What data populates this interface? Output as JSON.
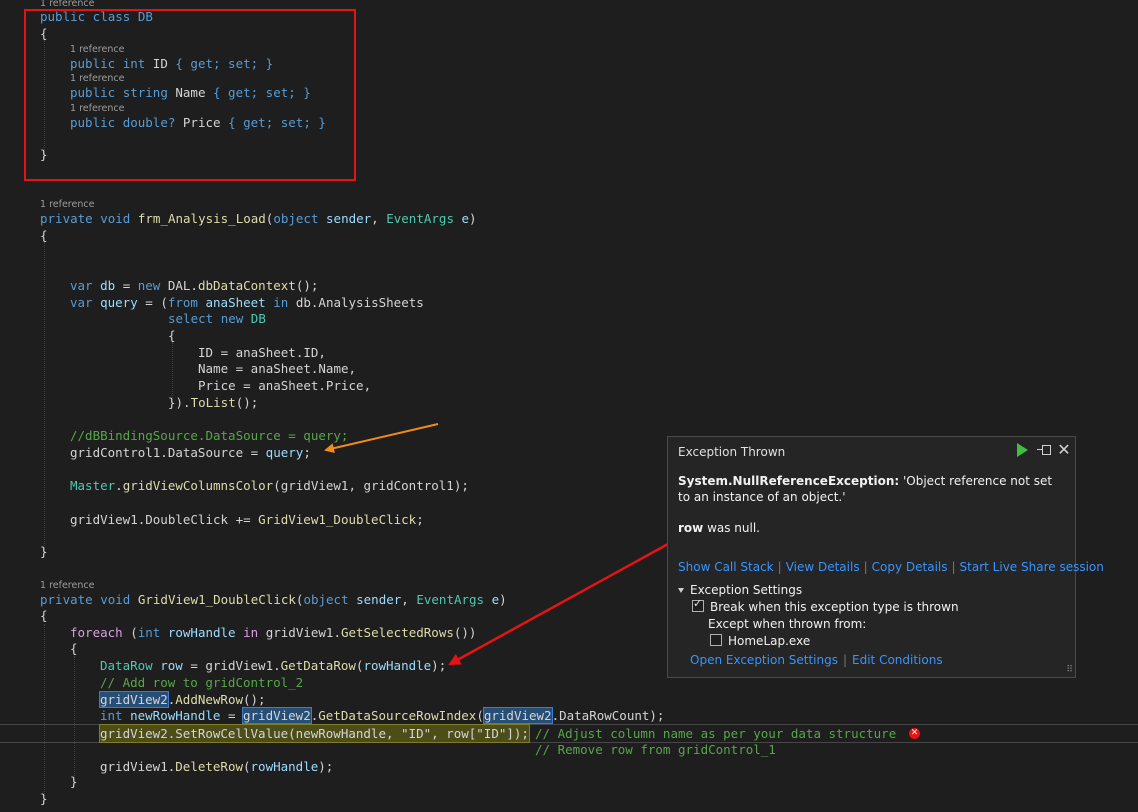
{
  "codelens": {
    "one_ref": "1 reference"
  },
  "code": {
    "db_class": "public class DB",
    "open_brace": "{",
    "close_brace": "}",
    "id_prop": {
      "kw1": "public",
      "kw2": "int",
      "name": " ID ",
      "body": "{ get; set; }"
    },
    "name_prop": {
      "kw1": "public",
      "kw2": "string",
      "name": " Name ",
      "body": "{ get; set; }"
    },
    "price_prop": {
      "kw1": "public",
      "kw2": "double?",
      "name": " Price ",
      "body": "{ get; set; }"
    },
    "load_sig": {
      "kw1": "private",
      "kw2": "void",
      "fn": "frm_Analysis_Load",
      "p1": "object",
      "p1n": "sender",
      "p2": "EventArgs",
      "p2n": "e"
    },
    "var_db": {
      "kw": "var",
      "v": "db",
      "eq": " = ",
      "new": "new",
      "ns": "DAL.",
      "fn": "dbDataContext",
      "end": "();"
    },
    "var_query": {
      "kw": "var",
      "v": "query",
      "eq": " = (",
      "from": "from",
      "vn": "anaSheet",
      "in": "in",
      "src": "db.AnalysisSheets"
    },
    "select_new": {
      "select": "select",
      "new": "new",
      "ty": "DB"
    },
    "assign_id": "ID = anaSheet.ID,",
    "assign_name": "Name = anaSheet.Name,",
    "assign_price": "Price = anaSheet.Price,",
    "tolist": {
      "pre": "}).",
      "fn": "ToList",
      "post": "();"
    },
    "comment_binding": "//dBBindingSource.DataSource = query;",
    "grid_ds": {
      "a": "gridControl1.DataSource = ",
      "b": "query",
      "c": ";"
    },
    "master_call": {
      "ty": "Master",
      "dot": ".",
      "fn": "gridViewColumnsColor",
      "args": "(gridView1, gridControl1);"
    },
    "dblclick_sub": {
      "a": "gridView1.DoubleClick += ",
      "fn": "GridView1_DoubleClick",
      "c": ";"
    },
    "dbl_sig": {
      "kw1": "private",
      "kw2": "void",
      "fn": "GridView1_DoubleClick",
      "p1": "object",
      "p1n": "sender",
      "p2": "EventArgs",
      "p2n": "e"
    },
    "foreach_line": {
      "kw": "foreach",
      "open": " (",
      "int": "int",
      "v": " rowHandle ",
      "in": "in",
      "rest": " gridView1.",
      "fn": "GetSelectedRows",
      "end": "())"
    },
    "datarow_line": {
      "ty": "DataRow",
      "v": " row ",
      "eq": "= gridView1.",
      "fn": "GetDataRow",
      "args": "(",
      "arg": "rowHandle",
      "end": ");"
    },
    "comment_add": "// Add row to gridControl_2",
    "addnew_line": {
      "obj": "gridView2",
      "dot": ".",
      "fn": "AddNewRow",
      "end": "();"
    },
    "newhandle_line": {
      "int": "int",
      "v": " newRowHandle ",
      "eq": "= ",
      "obj": "gridView2",
      "dot": ".",
      "fn": "GetDataSourceRowIndex",
      "open": "(",
      "obj2": "gridView2",
      "rest": ".DataRowCount);"
    },
    "setcell_line": {
      "text": "gridView2.SetRowCellValue(newRowHandle, \"ID\", row[\"ID\"]);"
    },
    "comment_adjust": "// Adjust column name as per your data structure",
    "comment_remove": "// Remove row from gridControl_1",
    "delete_line": {
      "a": "gridView1.",
      "fn": "DeleteRow",
      "args": "(",
      "arg": "rowHandle",
      "end": ");"
    }
  },
  "popup": {
    "title": "Exception Thrown",
    "exception_type": "System.NullReferenceException:",
    "exception_message": " 'Object reference not set to an instance of an object.'",
    "null_var": "row",
    "null_text": " was null.",
    "links": [
      "Show Call Stack",
      "View Details",
      "Copy Details",
      "Start Live Share session"
    ],
    "settings_header": "Exception Settings",
    "break_label": "Break when this exception type is thrown",
    "except_label": "Except when thrown from:",
    "module_label": "HomeLap.exe",
    "bottom_links": [
      "Open Exception Settings",
      "Edit Conditions"
    ],
    "break_checked": true,
    "module_checked": false,
    "icons": {
      "continue": "play-icon",
      "pin": "pin-icon",
      "close": "close-icon"
    }
  },
  "colors": {
    "annotation_red": "#e51414",
    "annotation_orange": "#f28a1c"
  }
}
